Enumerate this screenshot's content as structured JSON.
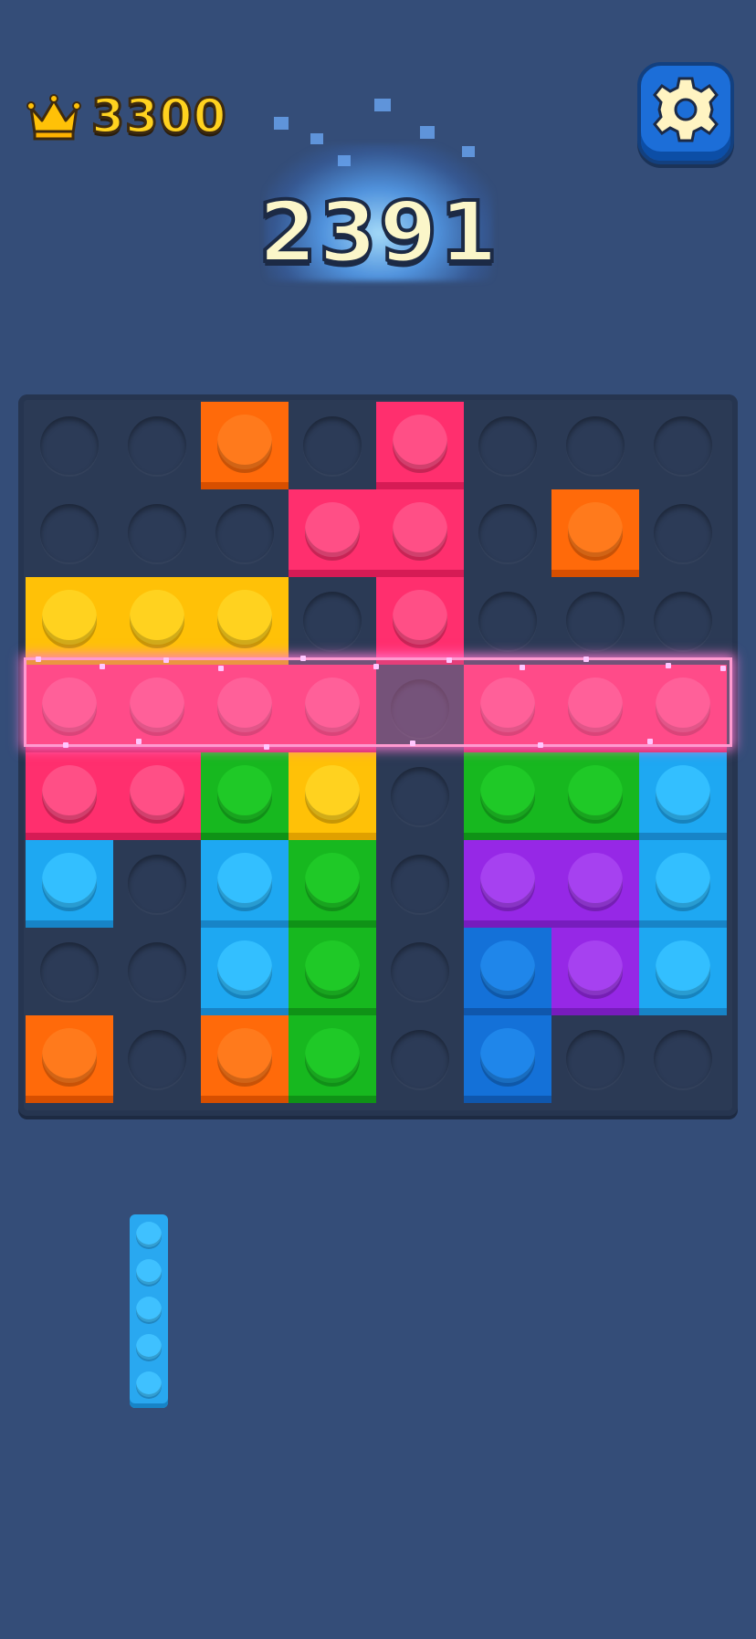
{
  "hud": {
    "best_score": "3300",
    "current_score": "2391",
    "best_icon": "crown-icon",
    "settings_icon": "gear-icon"
  },
  "colors": {
    "orange": {
      "base": "#ff6a0a",
      "shade": "#d74f00",
      "stud": "#ff7a1c"
    },
    "pink": {
      "base": "#ff2f6e",
      "shade": "#d61b55",
      "stud": "#ff4f86"
    },
    "yellow": {
      "base": "#ffc107",
      "shade": "#e0a000",
      "stud": "#ffd21f"
    },
    "green": {
      "base": "#17b81f",
      "shade": "#0f9216",
      "stud": "#1fc927"
    },
    "lightblue": {
      "base": "#1ea8f2",
      "shade": "#1784c7",
      "stud": "#33bfff"
    },
    "purple": {
      "base": "#9628e6",
      "shade": "#771cbd",
      "stud": "#a641f0"
    },
    "blue": {
      "base": "#1471d8",
      "shade": "#0f57ad",
      "stud": "#1f86ea"
    }
  },
  "board": {
    "rows": 8,
    "cols": 8,
    "highlighted_row": 3,
    "cells": [
      {
        "r": 0,
        "c": 2,
        "color": "orange"
      },
      {
        "r": 0,
        "c": 4,
        "color": "pink"
      },
      {
        "r": 1,
        "c": 3,
        "color": "pink"
      },
      {
        "r": 1,
        "c": 4,
        "color": "pink"
      },
      {
        "r": 1,
        "c": 6,
        "color": "orange"
      },
      {
        "r": 2,
        "c": 0,
        "color": "yellow"
      },
      {
        "r": 2,
        "c": 1,
        "color": "yellow"
      },
      {
        "r": 2,
        "c": 2,
        "color": "yellow"
      },
      {
        "r": 2,
        "c": 4,
        "color": "pink"
      },
      {
        "r": 3,
        "c": 0,
        "color": "pink"
      },
      {
        "r": 3,
        "c": 1,
        "color": "pink"
      },
      {
        "r": 3,
        "c": 2,
        "color": "pink"
      },
      {
        "r": 3,
        "c": 3,
        "color": "pink"
      },
      {
        "r": 3,
        "c": 5,
        "color": "pink"
      },
      {
        "r": 3,
        "c": 6,
        "color": "pink"
      },
      {
        "r": 3,
        "c": 7,
        "color": "pink"
      },
      {
        "r": 4,
        "c": 0,
        "color": "pink"
      },
      {
        "r": 4,
        "c": 1,
        "color": "pink"
      },
      {
        "r": 4,
        "c": 2,
        "color": "green"
      },
      {
        "r": 4,
        "c": 3,
        "color": "yellow"
      },
      {
        "r": 4,
        "c": 5,
        "color": "green"
      },
      {
        "r": 4,
        "c": 6,
        "color": "green"
      },
      {
        "r": 4,
        "c": 7,
        "color": "lightblue"
      },
      {
        "r": 5,
        "c": 0,
        "color": "lightblue"
      },
      {
        "r": 5,
        "c": 2,
        "color": "lightblue"
      },
      {
        "r": 5,
        "c": 3,
        "color": "green"
      },
      {
        "r": 5,
        "c": 5,
        "color": "purple"
      },
      {
        "r": 5,
        "c": 6,
        "color": "purple"
      },
      {
        "r": 5,
        "c": 7,
        "color": "lightblue"
      },
      {
        "r": 6,
        "c": 2,
        "color": "lightblue"
      },
      {
        "r": 6,
        "c": 3,
        "color": "green"
      },
      {
        "r": 6,
        "c": 5,
        "color": "blue"
      },
      {
        "r": 6,
        "c": 6,
        "color": "purple"
      },
      {
        "r": 6,
        "c": 7,
        "color": "lightblue"
      },
      {
        "r": 7,
        "c": 0,
        "color": "orange"
      },
      {
        "r": 7,
        "c": 2,
        "color": "orange"
      },
      {
        "r": 7,
        "c": 3,
        "color": "green"
      },
      {
        "r": 7,
        "c": 5,
        "color": "blue"
      }
    ]
  },
  "tray": {
    "pieces": [
      {
        "color": "lightblue",
        "length": 5,
        "orientation": "vertical"
      }
    ]
  }
}
